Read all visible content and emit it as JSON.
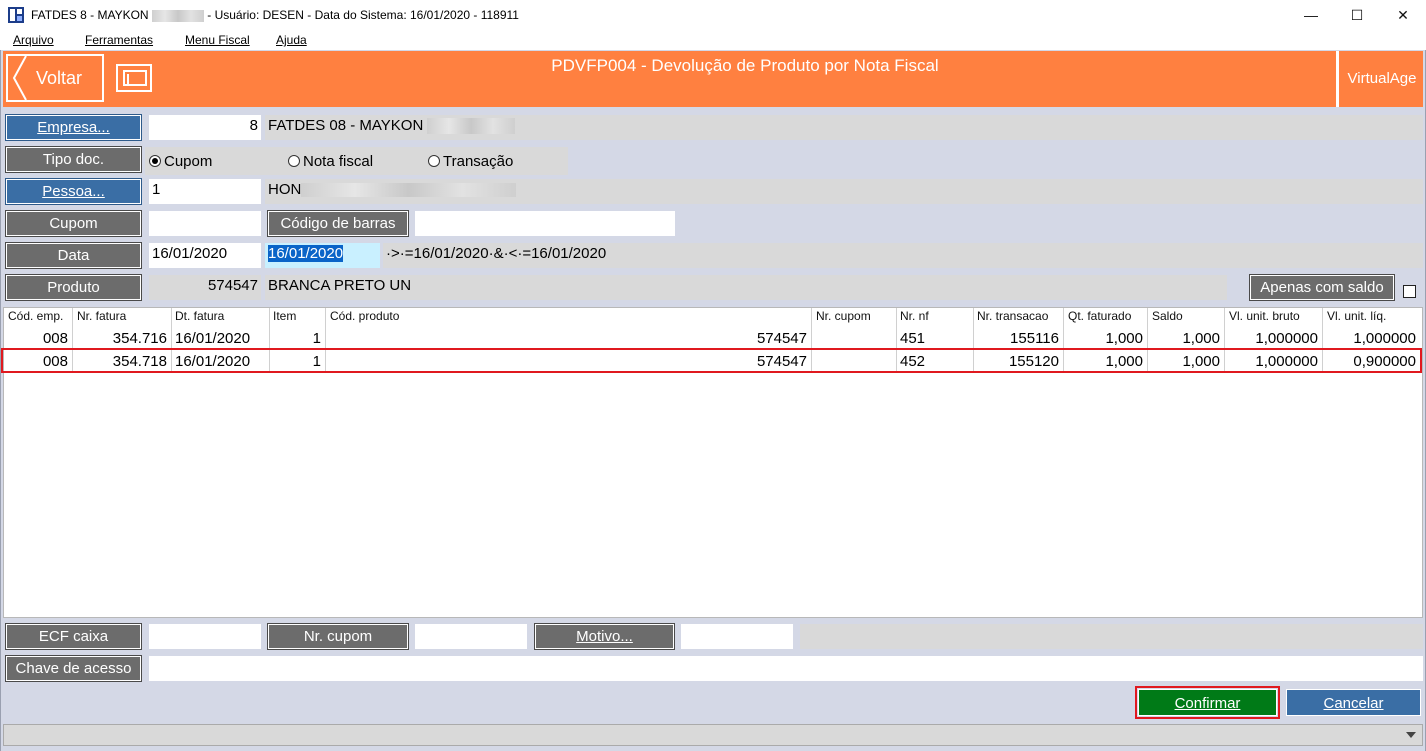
{
  "window": {
    "title_prefix": "FATDES 8 - MAYKON",
    "title_suffix": "- Usuário: DESEN - Data do Sistema: 16/01/2020 - 118911",
    "minimize": "—",
    "maximize": "☐",
    "close": "✕"
  },
  "menu": [
    "Arquivo",
    "Ferramentas",
    "Menu Fiscal",
    "Ajuda"
  ],
  "header": {
    "back_label": "Voltar",
    "title": "PDVFP004 - Devolução de Produto por Nota Fiscal",
    "brand": "VirtualAge"
  },
  "form": {
    "empresa_label": "Empresa...",
    "empresa_code": "8",
    "empresa_name": "FATDES 08 - MAYKON",
    "tipo_doc_label": "Tipo doc.",
    "tipo_options": [
      "Cupom",
      "Nota fiscal",
      "Transação"
    ],
    "tipo_selected": "Cupom",
    "pessoa_label": "Pessoa...",
    "pessoa_code": "1",
    "pessoa_name": "HON",
    "cupom_label": "Cupom",
    "cupom_value": "",
    "barcode_label": "Código de barras",
    "barcode_value": "",
    "data_label": "Data",
    "data_from": "16/01/2020",
    "data_to": "16/01/2020",
    "data_filter": "·>·=16/01/2020·&·<·=16/01/2020",
    "produto_label": "Produto",
    "produto_code": "574547",
    "produto_name": "BRANCA PRETO UN",
    "apenas_saldo_label": "Apenas com saldo",
    "apenas_saldo_checked": false
  },
  "grid": {
    "columns": [
      "Cód. emp.",
      "Nr. fatura",
      "Dt. fatura",
      "Item",
      "Cód. produto",
      "Nr. cupom",
      "Nr. nf",
      "Nr. transacao",
      "Qt. faturado",
      "Saldo",
      "Vl. unit. bruto",
      "Vl. unit. líq."
    ],
    "rows": [
      [
        "008",
        "354.716",
        "16/01/2020",
        "1",
        "574547",
        "",
        "451",
        "155116",
        "1,000",
        "1,000",
        "1,000000",
        "1,000000"
      ],
      [
        "008",
        "354.718",
        "16/01/2020",
        "1",
        "574547",
        "",
        "452",
        "155120",
        "1,000",
        "1,000",
        "1,000000",
        "0,900000"
      ]
    ],
    "selected_row": 1
  },
  "bottom": {
    "ecf_label": "ECF caixa",
    "ecf_value": "",
    "nr_cupom_label": "Nr. cupom",
    "nr_cupom_value": "",
    "motivo_label": "Motivo...",
    "motivo_value": "",
    "chave_label": "Chave de acesso",
    "chave_value": "",
    "confirm_label": "Confirmar",
    "cancel_label": "Cancelar"
  },
  "colors": {
    "header": "#ff8040",
    "blue_button": "#3a6ea5",
    "gray_button": "#6c6c6c",
    "confirm": "#007a17",
    "highlight": "#e0191f"
  }
}
